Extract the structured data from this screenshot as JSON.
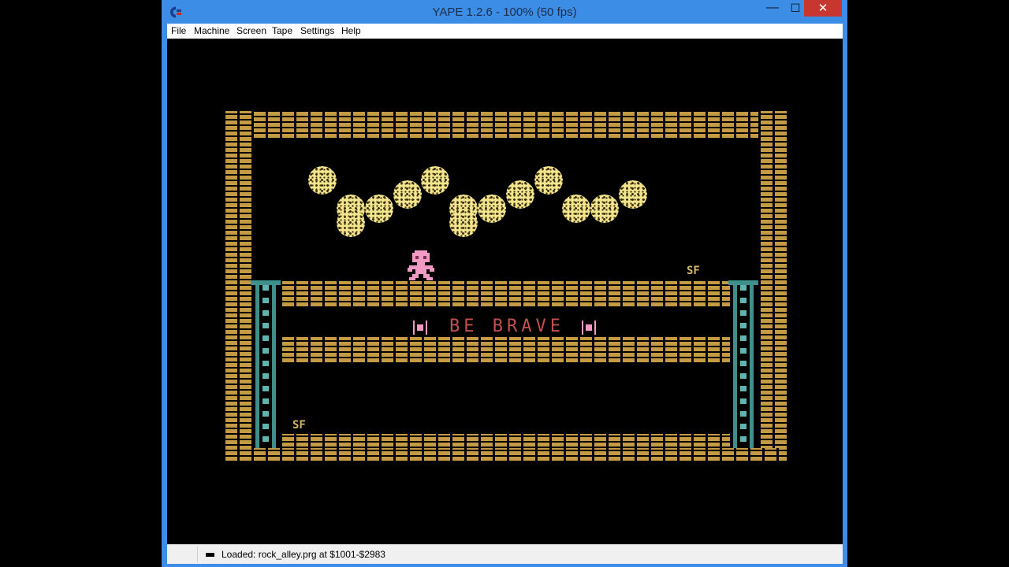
{
  "window": {
    "title": "YAPE 1.2.6 - 100% (50 fps)"
  },
  "controls": {
    "minimize": "—",
    "maximize": "◻",
    "close": "✕"
  },
  "menu": {
    "items": [
      "File",
      "Machine",
      "Screen",
      "Tape",
      "Settings",
      "Help"
    ]
  },
  "game": {
    "banner_text": "BE BRAVE",
    "markers": [
      "SF",
      "SF"
    ]
  },
  "status": {
    "text": "Loaded: rock_alley.prg at $1001-$2983"
  },
  "colors": {
    "brick": "#c49a45",
    "ladder": "#3f8f8c",
    "rock": "#f3e58e",
    "player": "#f29ac3",
    "banner": "#c2504e",
    "titlebar": "#3c8de6",
    "close_button": "#c7372f"
  },
  "icons": {
    "app": "commodore-logo-icon",
    "tape": "tape-icon",
    "banner_brackets": "bracket-icon"
  }
}
